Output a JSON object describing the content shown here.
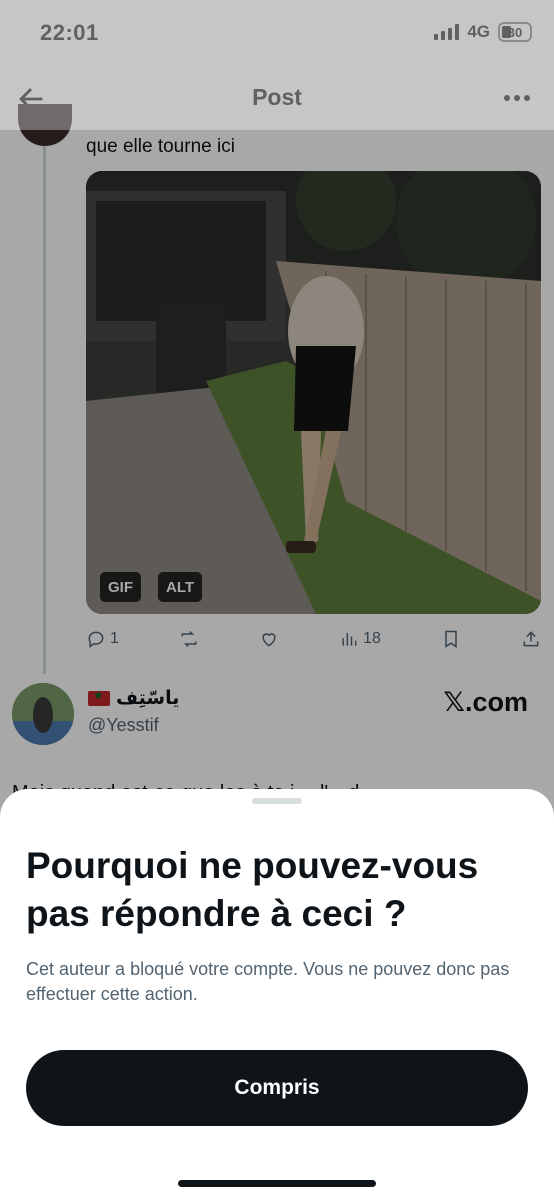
{
  "status_bar": {
    "time": "22:01",
    "network": "4G",
    "battery": "30"
  },
  "header": {
    "title": "Post"
  },
  "tweet": {
    "text": "que elle tourne ici",
    "media_badges": {
      "gif": "GIF",
      "alt": "ALT"
    },
    "actions": {
      "replies": "1",
      "views": "18"
    }
  },
  "reply": {
    "name": "ياسّتِف",
    "handle": "@Yesstif",
    "link_text": "𝕏.com",
    "truncated_text": "Mais quand est-ce que les à te j… l'…d…"
  },
  "sheet": {
    "title": "Pourquoi ne pouvez-vous pas répondre à ceci ?",
    "description": "Cet auteur a bloqué votre compte. Vous ne pouvez donc pas effectuer cette action.",
    "button_label": "Compris"
  },
  "icons": [
    "back-arrow-icon",
    "more-icon",
    "reply-icon",
    "repost-icon",
    "like-icon",
    "views-icon",
    "bookmark-icon",
    "share-icon"
  ]
}
